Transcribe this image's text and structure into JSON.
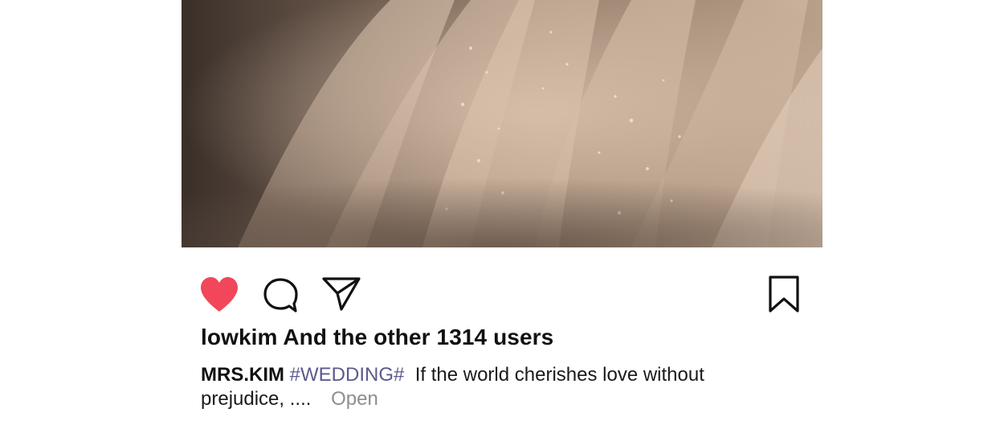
{
  "post": {
    "image": {
      "subject": "wedding-dress-skirt",
      "colors": {
        "base": "#6b584a",
        "highlight": "#e4cdb8",
        "shadow": "#3a2f29"
      }
    },
    "actions": {
      "like_icon": "heart-icon",
      "like_color": "#f2465a",
      "comment_icon": "speech-bubble-icon",
      "share_icon": "paper-plane-icon",
      "bookmark_icon": "bookmark-icon"
    },
    "likes_text": "lowkim And the other 1314 users",
    "caption": {
      "username": "MRS.KIM",
      "hashtag": "#WEDDING#",
      "text": "If the world cherishes love without prejudice, ....",
      "more_label": "Open"
    }
  }
}
